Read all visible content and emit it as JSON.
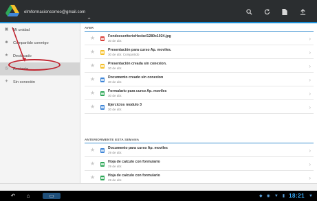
{
  "account": {
    "email": "elmformacioncorreo@gmail.com"
  },
  "topbar": {
    "actions": [
      {
        "icon": "search-icon",
        "glyph": "⚲"
      },
      {
        "icon": "refresh-icon",
        "glyph": "⟳"
      },
      {
        "icon": "document-icon",
        "glyph": "▮"
      },
      {
        "icon": "upload-icon",
        "glyph": "⤒"
      }
    ]
  },
  "sidebar": {
    "items": [
      {
        "label": "Mi unidad",
        "icon": "drive-icon",
        "glyph": "▣"
      },
      {
        "label": "Compartido conmigo",
        "icon": "people-icon",
        "glyph": "☻"
      },
      {
        "label": "Destacado",
        "icon": "star-icon",
        "glyph": "★"
      },
      {
        "label": "Reciente",
        "icon": "clock-icon",
        "glyph": "◷"
      },
      {
        "label": "Sin conexión",
        "icon": "pin-icon",
        "glyph": "✈"
      }
    ]
  },
  "sections": [
    {
      "header": "AYER",
      "files": [
        {
          "title": "FondoescritorioHecbel1280x1024.jpg",
          "subtitle": "30 de abr.",
          "type": "pdf"
        },
        {
          "title": "Presentación para curso Ap. moviles.",
          "subtitle": "30 de abr.  Compartido",
          "type": "slides"
        },
        {
          "title": "Presentación creada sin conexion.",
          "subtitle": "30 de abr.",
          "type": "slides"
        },
        {
          "title": "Documento creado sin conexion",
          "subtitle": "30 de abr.",
          "type": "doc"
        },
        {
          "title": "Formulario para curso Ap. moviles",
          "subtitle": "30 de abr.",
          "type": "form"
        },
        {
          "title": "Ejercicios modulo 3",
          "subtitle": "30 de abr.",
          "type": "doc"
        }
      ]
    },
    {
      "header": "ANTERIORMENTE ESTA SEMANA",
      "files": [
        {
          "title": "Documento para curso Ap. moviles",
          "subtitle": "29 de abr.",
          "type": "doc"
        },
        {
          "title": "Hoja de calculo con formulario",
          "subtitle": "29 de abr.",
          "type": "sheet"
        },
        {
          "title": "Hoja de calculo con formulario",
          "subtitle": "29 de abr.",
          "type": "sheet"
        }
      ]
    }
  ],
  "system": {
    "clock": "18:21"
  },
  "colors": {
    "accent": "#1a8fd8",
    "annotation": "#c0242f",
    "topbar": "#2b2e30"
  }
}
